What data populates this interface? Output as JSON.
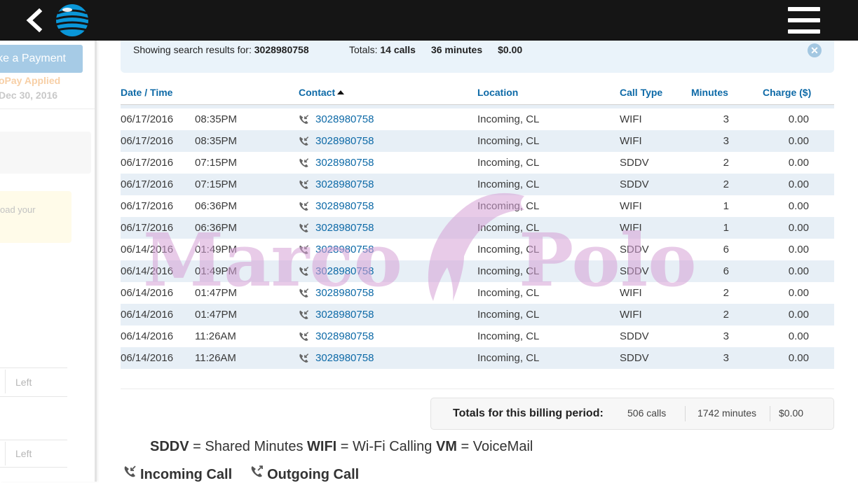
{
  "header": {
    "back_icon": "chevron-left-icon",
    "logo_icon": "att-globe-icon",
    "menu_icon": "hamburger-menu-icon",
    "colors": {
      "bar": "#151515",
      "logo": "#0a97d9"
    }
  },
  "sidebar": {
    "payment_label": "ke a Payment",
    "autopay_label": "oPay Applied",
    "due_date": "Dec 30, 2016",
    "upload_text": "oad your",
    "left_label_1": "Left",
    "left_label_2": "Left"
  },
  "search": {
    "prefix": "Showing search results for: ",
    "number": "3028980758",
    "totals_label": "Totals: ",
    "calls": "14 calls",
    "minutes": "36 minutes",
    "amount": "$0.00",
    "close_icon": "close-circle-icon"
  },
  "table": {
    "headers": {
      "datetime": "Date / Time",
      "contact": "Contact",
      "location": "Location",
      "call_type": "Call Type",
      "minutes": "Minutes",
      "charge": "Charge ($)"
    },
    "sort_icon": "sort-ascending-icon",
    "incoming_icon": "incoming-call-icon",
    "rows": [
      {
        "date": "06/17/2016",
        "time": "08:35PM",
        "contact": "3028980758",
        "location": "Incoming, CL",
        "type": "WIFI",
        "minutes": "3",
        "charge": "0.00"
      },
      {
        "date": "06/17/2016",
        "time": "08:35PM",
        "contact": "3028980758",
        "location": "Incoming, CL",
        "type": "WIFI",
        "minutes": "3",
        "charge": "0.00"
      },
      {
        "date": "06/17/2016",
        "time": "07:15PM",
        "contact": "3028980758",
        "location": "Incoming, CL",
        "type": "SDDV",
        "minutes": "2",
        "charge": "0.00"
      },
      {
        "date": "06/17/2016",
        "time": "07:15PM",
        "contact": "3028980758",
        "location": "Incoming, CL",
        "type": "SDDV",
        "minutes": "2",
        "charge": "0.00"
      },
      {
        "date": "06/17/2016",
        "time": "06:36PM",
        "contact": "3028980758",
        "location": "Incoming, CL",
        "type": "WIFI",
        "minutes": "1",
        "charge": "0.00"
      },
      {
        "date": "06/17/2016",
        "time": "06:36PM",
        "contact": "3028980758",
        "location": "Incoming, CL",
        "type": "WIFI",
        "minutes": "1",
        "charge": "0.00"
      },
      {
        "date": "06/14/2016",
        "time": "01:49PM",
        "contact": "3028980758",
        "location": "Incoming, CL",
        "type": "SDDV",
        "minutes": "6",
        "charge": "0.00"
      },
      {
        "date": "06/14/2016",
        "time": "01:49PM",
        "contact": "3028980758",
        "location": "Incoming, CL",
        "type": "SDDV",
        "minutes": "6",
        "charge": "0.00"
      },
      {
        "date": "06/14/2016",
        "time": "01:47PM",
        "contact": "3028980758",
        "location": "Incoming, CL",
        "type": "WIFI",
        "minutes": "2",
        "charge": "0.00"
      },
      {
        "date": "06/14/2016",
        "time": "01:47PM",
        "contact": "3028980758",
        "location": "Incoming, CL",
        "type": "WIFI",
        "minutes": "2",
        "charge": "0.00"
      },
      {
        "date": "06/14/2016",
        "time": "11:26AM",
        "contact": "3028980758",
        "location": "Incoming, CL",
        "type": "SDDV",
        "minutes": "3",
        "charge": "0.00"
      },
      {
        "date": "06/14/2016",
        "time": "11:26AM",
        "contact": "3028980758",
        "location": "Incoming, CL",
        "type": "SDDV",
        "minutes": "3",
        "charge": "0.00"
      }
    ]
  },
  "billing": {
    "label": "Totals for this billing period:",
    "calls": "506 calls",
    "minutes": "1742 minutes",
    "amount": "$0.00"
  },
  "legend": {
    "sddv_code": "SDDV",
    "sddv_text": " = Shared Minutes ",
    "wifi_code": "WIFI",
    "wifi_text": " = Wi-Fi Calling ",
    "vm_code": "VM",
    "vm_text": " = VoiceMail",
    "incoming_icon": "incoming-call-icon",
    "incoming_label": "Incoming Call",
    "outgoing_icon": "outgoing-call-icon",
    "outgoing_label": "Outgoing Call"
  },
  "watermark": {
    "left_text": "Marco",
    "right_text": "Polo",
    "icon": "dolphin-icon",
    "color": "#d6a0d6"
  }
}
